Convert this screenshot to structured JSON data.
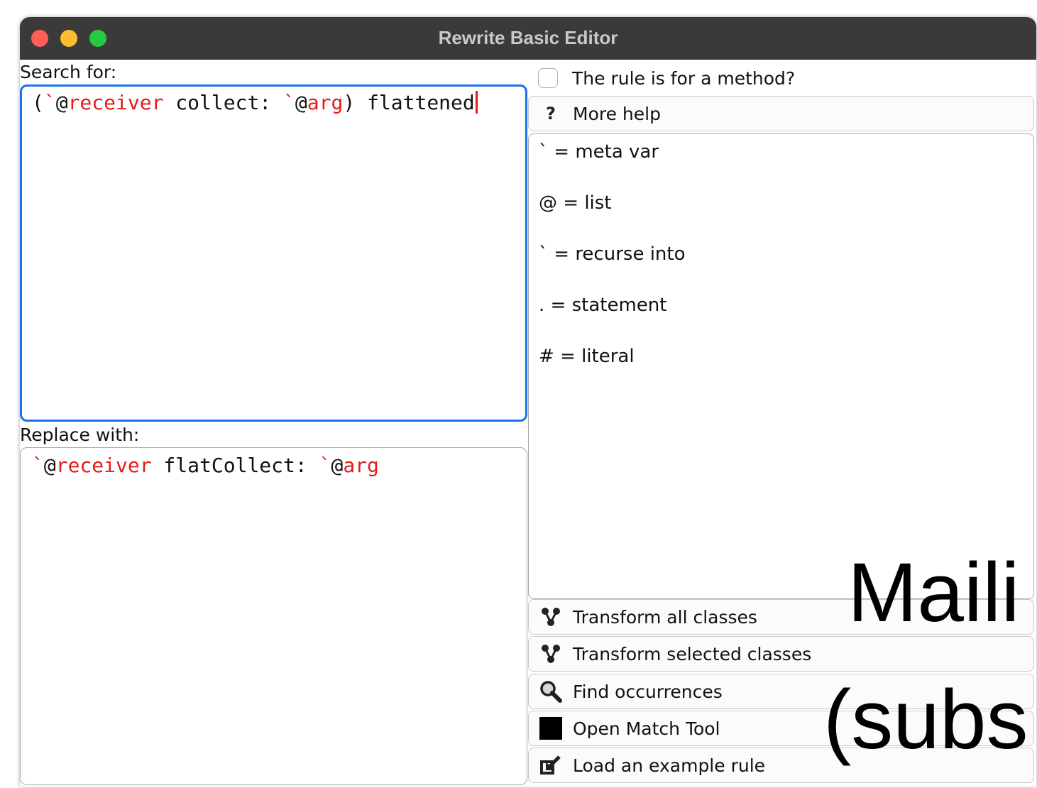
{
  "window": {
    "title": "Rewrite Basic Editor"
  },
  "search": {
    "label": "Search for:",
    "code": [
      {
        "t": "(",
        "c": "kw"
      },
      {
        "t": "`",
        "c": "mv"
      },
      {
        "t": "@",
        "c": "kw"
      },
      {
        "t": "receiver",
        "c": "mv"
      },
      {
        "t": " collect: ",
        "c": "kw"
      },
      {
        "t": "`",
        "c": "mv"
      },
      {
        "t": "@",
        "c": "kw"
      },
      {
        "t": "arg",
        "c": "mv"
      },
      {
        "t": ") flattened",
        "c": "kw"
      }
    ]
  },
  "replace": {
    "label": "Replace with:",
    "code": [
      {
        "t": "`",
        "c": "mv"
      },
      {
        "t": "@",
        "c": "kw"
      },
      {
        "t": "receiver",
        "c": "mv"
      },
      {
        "t": " flatCollect: ",
        "c": "kw"
      },
      {
        "t": "`",
        "c": "mv"
      },
      {
        "t": "@",
        "c": "kw"
      },
      {
        "t": "arg",
        "c": "mv"
      }
    ]
  },
  "method_checkbox": {
    "label": "The rule is for a method?",
    "checked": false
  },
  "more_help": {
    "label": "More help",
    "icon": "question-icon"
  },
  "legend": {
    "items": [
      "` = meta var",
      "@ = list",
      "` = recurse into",
      ". = statement",
      "# = literal"
    ]
  },
  "actions": {
    "transform_all": {
      "label": "Transform all classes",
      "icon": "transform-icon"
    },
    "transform_selected": {
      "label": "Transform selected classes",
      "icon": "transform-icon"
    },
    "find": {
      "label": "Find occurrences",
      "icon": "magnifier-icon"
    },
    "match_tool": {
      "label": "Open Match Tool",
      "icon": "black-square-icon"
    },
    "load_example": {
      "label": "Load an example rule",
      "icon": "load-icon"
    }
  },
  "overlay": {
    "line1": "Maili",
    "line2": "(subs"
  }
}
